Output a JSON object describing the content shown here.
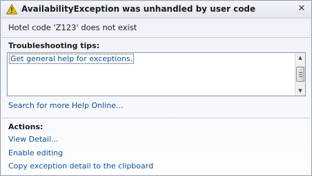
{
  "dialog": {
    "title": "AvailabilityException was unhandled by user code",
    "message": "Hotel code 'Z123' does not exist",
    "title_icon": "warning-icon",
    "close_icon": "close-icon"
  },
  "troubleshooting": {
    "heading": "Troubleshooting tips:",
    "tips": [
      "Get general help for exceptions."
    ],
    "search_link": "Search for more Help Online..."
  },
  "actions": {
    "heading": "Actions:",
    "items": [
      "View Detail...",
      "Enable editing",
      "Copy exception detail to the clipboard"
    ]
  },
  "colors": {
    "link": "#0b4f9e",
    "warning": "#f2c200"
  }
}
